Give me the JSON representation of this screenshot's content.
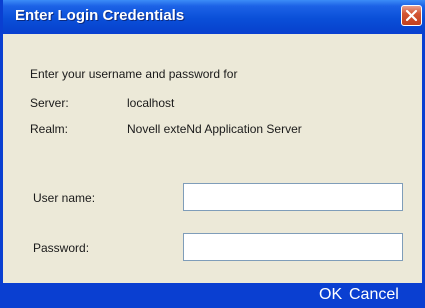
{
  "dialog": {
    "title": "Enter Login Credentials",
    "close_icon": "close-icon",
    "intro": "Enter your username and password for",
    "server_label": "Server:",
    "server_value": "localhost",
    "realm_label": "Realm:",
    "realm_value": "Novell exteNd Application Server",
    "username_label": "User name:",
    "username_value": "",
    "password_label": "Password:",
    "password_value": "",
    "ok_label": "OK",
    "cancel_label": "Cancel"
  },
  "colors": {
    "titlebar": "#0a4fd8",
    "frame": "#0a3fd1",
    "background": "#ece9d8",
    "close_button": "#c2401e"
  }
}
